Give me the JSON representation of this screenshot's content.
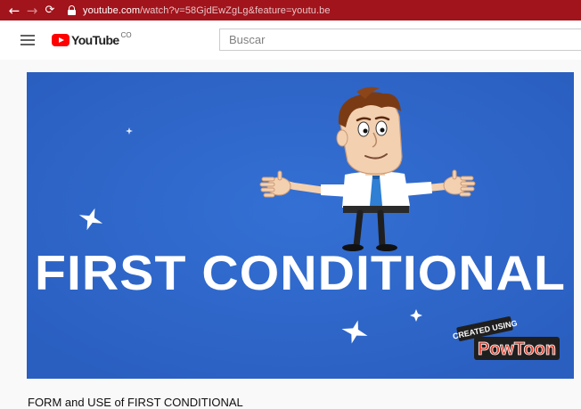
{
  "browser": {
    "url_host": "youtube.com",
    "url_rest": "/watch?v=58GjdEwZgLg&feature=youtu.be",
    "accent": "#a1141c"
  },
  "header": {
    "logo_text": "YouTube",
    "logo_country": "CO",
    "search_placeholder": "Buscar"
  },
  "video": {
    "background": "#2e66c8",
    "overlay_text": "FIRST CONDITIONAL",
    "badge_top": "CREATED USING",
    "badge_brand": "PowToon",
    "title": "FORM and USE of FIRST CONDITIONAL"
  },
  "icons": [
    "back-arrow-icon",
    "forward-arrow-icon",
    "reload-icon",
    "lock-icon",
    "hamburger-icon",
    "youtube-logo-icon",
    "sparkle-icon"
  ]
}
